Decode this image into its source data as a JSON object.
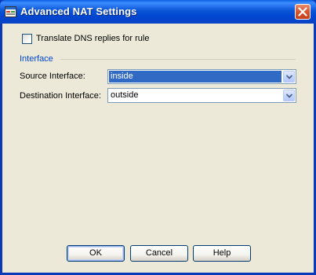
{
  "window": {
    "title": "Advanced NAT Settings"
  },
  "options": {
    "translate_dns_label": "Translate DNS replies for rule",
    "translate_dns_checked": false
  },
  "interface_group": {
    "title": "Interface",
    "source_label": "Source Interface:",
    "source_value": "inside",
    "destination_label": "Destination Interface:",
    "destination_value": "outside"
  },
  "buttons": {
    "ok": "OK",
    "cancel": "Cancel",
    "help": "Help"
  },
  "icons": {
    "app": "app-window-icon",
    "close": "close-icon",
    "dropdown": "chevron-down-icon"
  },
  "colors": {
    "titlebar": "#0054e3",
    "selection": "#316ac5",
    "group_title": "#0046d5",
    "dialog_bg": "#ece9d8"
  }
}
